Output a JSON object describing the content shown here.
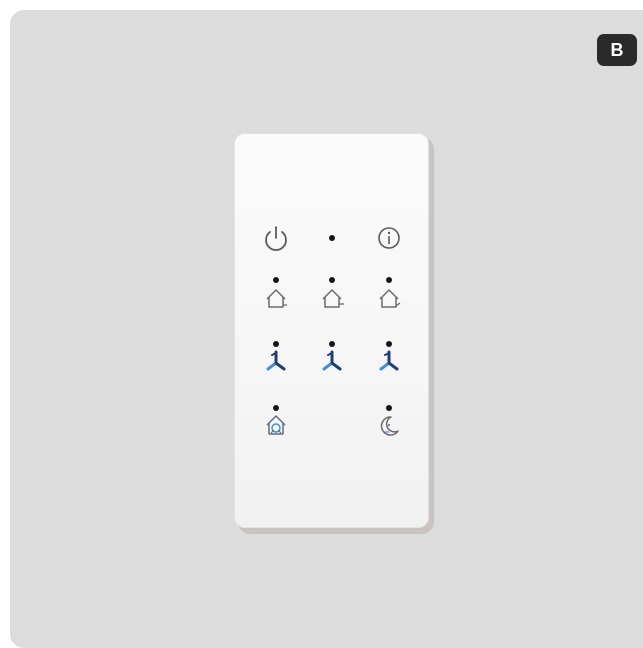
{
  "badge": {
    "label": "B"
  },
  "colors": {
    "background": "#dcdcdc",
    "device_face": "#f7f7f7",
    "icon_grey": "#6b6b6b",
    "fan_dark": "#1f3f73",
    "fan_blue": "#3f8fd6",
    "led": "#151515"
  },
  "device": {
    "rows": [
      [
        {
          "name": "power-button",
          "icon": "power-icon"
        },
        {
          "name": "status-led",
          "icon": "led-indicator"
        },
        {
          "name": "info-button",
          "icon": "info-icon"
        }
      ],
      [
        {
          "name": "home-mode-1-button",
          "icon": "house-icon"
        },
        {
          "name": "home-mode-2-button",
          "icon": "house-icon"
        },
        {
          "name": "home-mode-3-button",
          "icon": "house-icon"
        }
      ],
      [
        {
          "name": "fan-speed-1-button",
          "icon": "fan-icon"
        },
        {
          "name": "fan-speed-2-button",
          "icon": "fan-icon"
        },
        {
          "name": "fan-speed-3-button",
          "icon": "fan-icon"
        }
      ],
      [
        {
          "name": "boost-house-button",
          "icon": "house-fan-icon"
        },
        {
          "name": "night-mode-button",
          "icon": "moon-icon"
        }
      ]
    ]
  }
}
